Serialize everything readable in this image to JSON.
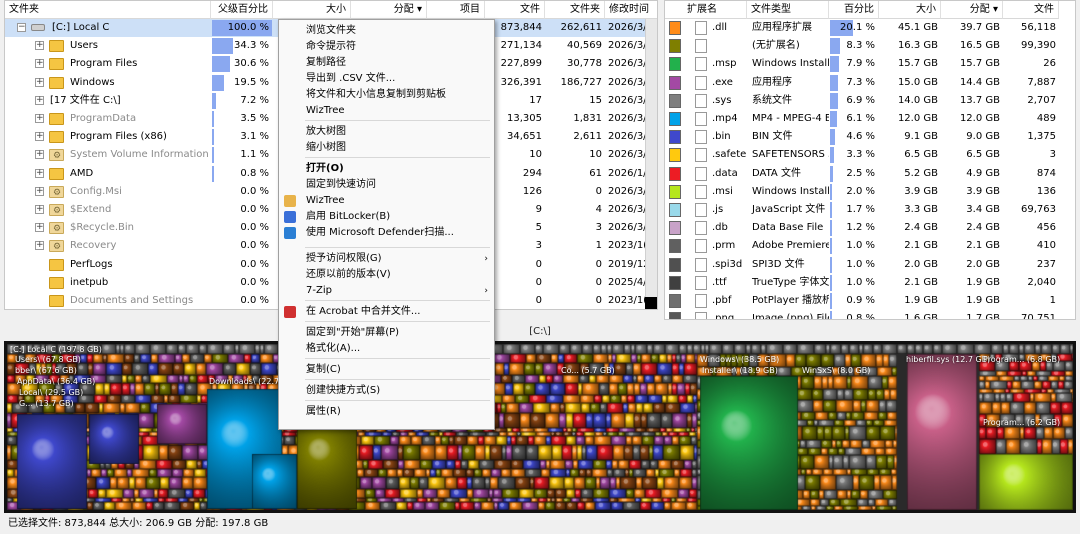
{
  "left_table": {
    "headers": [
      "文件夹",
      "父级百分比",
      "大小",
      "分配 ▾",
      "项目",
      "文件",
      "文件夹",
      "修改时间"
    ],
    "rows": [
      {
        "name": "[C:] Local C",
        "pct": "100.0 %",
        "pct_frac": 1.0,
        "size": "",
        "alloc": "",
        "items": "",
        "files": "873,844",
        "folders": "262,611",
        "mtime": "2026/3/",
        "expander": "−",
        "icon": "drive",
        "gray": false,
        "selected": true
      },
      {
        "name": "Users",
        "pct": "34.3 %",
        "pct_frac": 0.343,
        "size": "",
        "alloc": "",
        "items": "",
        "files": "271,134",
        "folders": "40,569",
        "mtime": "2026/3/",
        "expander": "+",
        "icon": "folder",
        "gray": false
      },
      {
        "name": "Program Files",
        "pct": "30.6 %",
        "pct_frac": 0.306,
        "size": "",
        "alloc": "",
        "items": "",
        "files": "227,899",
        "folders": "30,778",
        "mtime": "2026/3/",
        "expander": "+",
        "icon": "folder",
        "gray": false
      },
      {
        "name": "Windows",
        "pct": "19.5 %",
        "pct_frac": 0.195,
        "size": "",
        "alloc": "",
        "items": "",
        "files": "326,391",
        "folders": "186,727",
        "mtime": "2026/3/",
        "expander": "+",
        "icon": "folder",
        "gray": false
      },
      {
        "name": "[17 文件在 C:\\]",
        "pct": "7.2 %",
        "pct_frac": 0.072,
        "size": "",
        "alloc": "",
        "items": "",
        "files": "17",
        "folders": "15",
        "mtime": "2026/3/",
        "expander": "+",
        "icon": "none",
        "gray": false
      },
      {
        "name": "ProgramData",
        "pct": "3.5 %",
        "pct_frac": 0.035,
        "size": "",
        "alloc": "",
        "items": "",
        "files": "13,305",
        "folders": "1,831",
        "mtime": "2026/3/",
        "expander": "+",
        "icon": "folder",
        "gray": true
      },
      {
        "name": "Program Files (x86)",
        "pct": "3.1 %",
        "pct_frac": 0.031,
        "size": "",
        "alloc": "",
        "items": "",
        "files": "34,651",
        "folders": "2,611",
        "mtime": "2026/3/",
        "expander": "+",
        "icon": "folder",
        "gray": false
      },
      {
        "name": "System Volume Information",
        "pct": "1.1 %",
        "pct_frac": 0.011,
        "size": "",
        "alloc": "",
        "items": "",
        "files": "10",
        "folders": "10",
        "mtime": "2026/3/",
        "expander": "+",
        "icon": "gear",
        "gray": true
      },
      {
        "name": "AMD",
        "pct": "0.8 %",
        "pct_frac": 0.008,
        "size": "",
        "alloc": "",
        "items": "",
        "files": "294",
        "folders": "61",
        "mtime": "2026/1/",
        "expander": "+",
        "icon": "folder",
        "gray": false
      },
      {
        "name": "Config.Msi",
        "pct": "0.0 %",
        "pct_frac": 0.0,
        "size": "",
        "alloc": "",
        "items": "",
        "files": "126",
        "folders": "0",
        "mtime": "2026/3/",
        "expander": "+",
        "icon": "gear",
        "gray": true
      },
      {
        "name": "$Extend",
        "pct": "0.0 %",
        "pct_frac": 0.0,
        "size": "",
        "alloc": "",
        "items": "",
        "files": "9",
        "folders": "4",
        "mtime": "2026/3/",
        "expander": "+",
        "icon": "gear",
        "gray": true
      },
      {
        "name": "$Recycle.Bin",
        "pct": "0.0 %",
        "pct_frac": 0.0,
        "size": "",
        "alloc": "",
        "items": "",
        "files": "5",
        "folders": "3",
        "mtime": "2026/3/",
        "expander": "+",
        "icon": "gear",
        "gray": true
      },
      {
        "name": "Recovery",
        "pct": "0.0 %",
        "pct_frac": 0.0,
        "size": "",
        "alloc": "",
        "items": "",
        "files": "3",
        "folders": "1",
        "mtime": "2023/1(",
        "expander": "+",
        "icon": "gear",
        "gray": true
      },
      {
        "name": "PerfLogs",
        "pct": "0.0 %",
        "pct_frac": 0.0,
        "size": "",
        "alloc": "",
        "items": "",
        "files": "0",
        "folders": "0",
        "mtime": "2019/12",
        "expander": "",
        "icon": "folder",
        "gray": false
      },
      {
        "name": "inetpub",
        "pct": "0.0 %",
        "pct_frac": 0.0,
        "size": "",
        "alloc": "",
        "items": "",
        "files": "0",
        "folders": "0",
        "mtime": "2025/4/",
        "expander": "",
        "icon": "folder",
        "gray": false
      },
      {
        "name": "Documents and Settings",
        "pct": "0.0 %",
        "pct_frac": 0.0,
        "size": "",
        "alloc": "",
        "items": "",
        "files": "0",
        "folders": "0",
        "mtime": "2023/1(",
        "expander": "",
        "icon": "folder",
        "gray": true
      }
    ]
  },
  "right_table": {
    "headers": [
      "扩展名",
      "文件类型",
      "百分比",
      "大小",
      "分配 ▾",
      "文件"
    ],
    "rows": [
      {
        "color": "#ff8c1a",
        "ext": ".dll",
        "type": "应用程序扩展",
        "pct": "20.1 %",
        "pct_frac": 0.201,
        "size": "45.1 GB",
        "alloc": "39.7 GB",
        "files": "56,118"
      },
      {
        "color": "#7f7f00",
        "ext": "",
        "type": "(无扩展名)",
        "pct": "8.3 %",
        "pct_frac": 0.083,
        "size": "16.3 GB",
        "alloc": "16.5 GB",
        "files": "99,390"
      },
      {
        "color": "#22b14c",
        "ext": ".msp",
        "type": "Windows Installe",
        "pct": "7.9 %",
        "pct_frac": 0.079,
        "size": "15.7 GB",
        "alloc": "15.7 GB",
        "files": "26"
      },
      {
        "color": "#a349a4",
        "ext": ".exe",
        "type": "应用程序",
        "pct": "7.3 %",
        "pct_frac": 0.073,
        "size": "15.0 GB",
        "alloc": "14.4 GB",
        "files": "7,887"
      },
      {
        "color": "#7f7f7f",
        "ext": ".sys",
        "type": "系统文件",
        "pct": "6.9 %",
        "pct_frac": 0.069,
        "size": "14.0 GB",
        "alloc": "13.7 GB",
        "files": "2,707"
      },
      {
        "color": "#00a2e8",
        "ext": ".mp4",
        "type": "MP4 - MPEG-4 E",
        "pct": "6.1 %",
        "pct_frac": 0.061,
        "size": "12.0 GB",
        "alloc": "12.0 GB",
        "files": "489"
      },
      {
        "color": "#3f48cc",
        "ext": ".bin",
        "type": "BIN 文件",
        "pct": "4.6 %",
        "pct_frac": 0.046,
        "size": "9.1 GB",
        "alloc": "9.0 GB",
        "files": "1,375"
      },
      {
        "color": "#ffc90e",
        "ext": ".safete",
        "type": "SAFETENSORS 3",
        "pct": "3.3 %",
        "pct_frac": 0.033,
        "size": "6.5 GB",
        "alloc": "6.5 GB",
        "files": "3"
      },
      {
        "color": "#ed1c24",
        "ext": ".data",
        "type": "DATA 文件",
        "pct": "2.5 %",
        "pct_frac": 0.025,
        "size": "5.2 GB",
        "alloc": "4.9 GB",
        "files": "874"
      },
      {
        "color": "#b5e61d",
        "ext": ".msi",
        "type": "Windows Installe",
        "pct": "2.0 %",
        "pct_frac": 0.02,
        "size": "3.9 GB",
        "alloc": "3.9 GB",
        "files": "136"
      },
      {
        "color": "#99d9ea",
        "ext": ".js",
        "type": "JavaScript 文件",
        "pct": "1.7 %",
        "pct_frac": 0.017,
        "size": "3.3 GB",
        "alloc": "3.4 GB",
        "files": "69,763"
      },
      {
        "color": "#c8a2c8",
        "ext": ".db",
        "type": "Data Base File",
        "pct": "1.2 %",
        "pct_frac": 0.012,
        "size": "2.4 GB",
        "alloc": "2.4 GB",
        "files": "456"
      },
      {
        "color": "#606060",
        "ext": ".prm",
        "type": "Adobe Premiere",
        "pct": "1.0 %",
        "pct_frac": 0.01,
        "size": "2.1 GB",
        "alloc": "2.1 GB",
        "files": "410"
      },
      {
        "color": "#505050",
        "ext": ".spi3d",
        "type": "SPI3D 文件",
        "pct": "1.0 %",
        "pct_frac": 0.01,
        "size": "2.0 GB",
        "alloc": "2.0 GB",
        "files": "237"
      },
      {
        "color": "#404040",
        "ext": ".ttf",
        "type": "TrueType 字体文",
        "pct": "1.0 %",
        "pct_frac": 0.01,
        "size": "2.1 GB",
        "alloc": "1.9 GB",
        "files": "2,040"
      },
      {
        "color": "#707070",
        "ext": ".pbf",
        "type": "PotPlayer 播放析",
        "pct": "0.9 %",
        "pct_frac": 0.009,
        "size": "1.9 GB",
        "alloc": "1.9 GB",
        "files": "1"
      },
      {
        "color": "#585858",
        "ext": ".png",
        "type": "Image (png) File",
        "pct": "0.8 %",
        "pct_frac": 0.008,
        "size": "1.6 GB",
        "alloc": "1.7 GB",
        "files": "70,751"
      }
    ]
  },
  "path_bar": "[C:\\]",
  "treemap": {
    "labels": [
      "[C:] Local C  (197.8 GB)",
      "Users\\  (67.8 GB)",
      "bber\\  (67.6 GB)",
      "AppData\\  (36.4 GB)",
      "Local\\  (29.5 GB)",
      "G...  (13.7 GB)",
      "Downloads\\  (22.7 GB)",
      "Co...  (5.7 GB)",
      "Windows\\  (38.5 GB)",
      "Installer\\  (18.9 GB)",
      "WinSxS\\  (8.0 GB)",
      "hiberfil.sys  (12.7 GB)",
      "Program...  (6.8 GB)",
      "Program...  (6.2 GB)"
    ]
  },
  "status": "已选择文件: 873,844  总大小: 206.9 GB  分配: 197.8 GB",
  "context_menu": {
    "items": [
      {
        "label": "浏览文件夹",
        "bold": false
      },
      {
        "label": "命令提示符",
        "bold": false
      },
      {
        "label": "复制路径",
        "bold": false
      },
      {
        "label": "导出到 .CSV 文件...",
        "bold": false
      },
      {
        "label": "将文件和大小信息复制到剪贴板",
        "bold": false
      },
      {
        "label": "WizTree",
        "bold": false
      },
      {
        "label": "放大树图",
        "bold": false
      },
      {
        "label": "缩小树图",
        "bold": false
      },
      {
        "label": "打开(O)",
        "bold": true
      },
      {
        "label": "固定到快速访问",
        "bold": false
      },
      {
        "label": "WizTree",
        "bold": false
      },
      {
        "label": "启用 BitLocker(B)",
        "bold": false
      },
      {
        "label": "使用 Microsoft Defender扫描...",
        "bold": false
      },
      {
        "label": "授予访问权限(G)",
        "bold": false
      },
      {
        "label": "还原以前的版本(V)",
        "bold": false
      },
      {
        "label": "7-Zip",
        "bold": false
      },
      {
        "label": "在 Acrobat 中合并文件...",
        "bold": false
      },
      {
        "label": "固定到\"开始\"屏幕(P)",
        "bold": false
      },
      {
        "label": "格式化(A)...",
        "bold": false
      },
      {
        "label": "复制(C)",
        "bold": false
      },
      {
        "label": "创建快捷方式(S)",
        "bold": false
      },
      {
        "label": "属性(R)",
        "bold": false
      }
    ],
    "submenu_arrow": "›"
  },
  "colors": {
    "selection": "#cde0f7",
    "pct_bar": "#8aa8f0",
    "menu_bg": "#f9f9f9"
  }
}
